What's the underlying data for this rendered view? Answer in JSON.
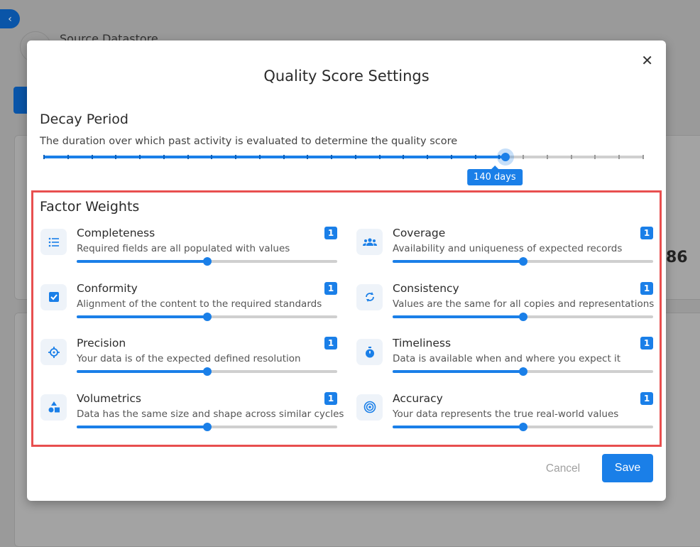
{
  "background": {
    "back_icon": "chevron-left-icon",
    "datastore_title": "Source Datastore",
    "score_fragment": "86"
  },
  "modal": {
    "title": "Quality Score Settings",
    "close_icon": "close-icon",
    "decay": {
      "heading": "Decay Period",
      "description": "The duration over which past activity is evaluated to determine the quality score",
      "value_label": "140 days",
      "value": 140,
      "fraction": 0.77
    },
    "factor_weights": {
      "heading": "Factor Weights",
      "factors": [
        {
          "name": "Completeness",
          "description": "Required fields are all populated with values",
          "weight": "1",
          "icon": "list-icon",
          "fraction": 0.5
        },
        {
          "name": "Coverage",
          "description": "Availability and uniqueness of expected records",
          "weight": "1",
          "icon": "group-icon",
          "fraction": 0.5
        },
        {
          "name": "Conformity",
          "description": "Alignment of the content to the required standards",
          "weight": "1",
          "icon": "checkbox-icon",
          "fraction": 0.5
        },
        {
          "name": "Consistency",
          "description": "Values are the same for all copies and representations",
          "weight": "1",
          "icon": "sync-icon",
          "fraction": 0.5
        },
        {
          "name": "Precision",
          "description": "Your data is of the expected defined resolution",
          "weight": "1",
          "icon": "crosshair-icon",
          "fraction": 0.5
        },
        {
          "name": "Timeliness",
          "description": "Data is available when and where you expect it",
          "weight": "1",
          "icon": "stopwatch-icon",
          "fraction": 0.5
        },
        {
          "name": "Volumetrics",
          "description": "Data has the same size and shape across similar cycles",
          "weight": "1",
          "icon": "shapes-icon",
          "fraction": 0.5
        },
        {
          "name": "Accuracy",
          "description": "Your data represents the true real-world values",
          "weight": "1",
          "icon": "target-icon",
          "fraction": 0.5
        }
      ]
    },
    "cancel_label": "Cancel",
    "save_label": "Save",
    "colors": {
      "accent": "#1a7fe8",
      "highlight_border": "#e84f4f"
    }
  }
}
